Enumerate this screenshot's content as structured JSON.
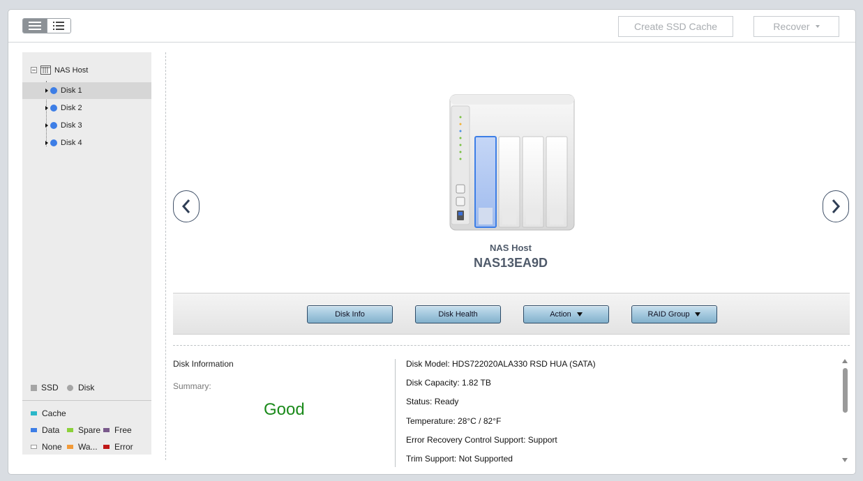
{
  "toolbar": {
    "create_ssd_cache": "Create SSD Cache",
    "recover": "Recover"
  },
  "tree": {
    "root": "NAS Host",
    "disks": [
      "Disk 1",
      "Disk 2",
      "Disk 3",
      "Disk 4"
    ],
    "selected_index": 0
  },
  "legend": {
    "ssd": "SSD",
    "disk": "Disk",
    "cache": "Cache",
    "data": "Data",
    "spare": "Spare",
    "free": "Free",
    "none": "None",
    "warning": "Wa...",
    "error": "Error",
    "colors": {
      "cache": "#2ab7c9",
      "data": "#3d7ee6",
      "spare": "#8bd13a",
      "free": "#7a5a8c",
      "none": "#ffffff",
      "warning": "#f29a38",
      "error": "#c01818"
    }
  },
  "device": {
    "host_label": "NAS Host",
    "name": "NAS13EA9D"
  },
  "actions": {
    "disk_info": "Disk Info",
    "disk_health": "Disk Health",
    "action": "Action",
    "raid_group": "RAID Group"
  },
  "disk_info": {
    "heading": "Disk Information",
    "summary_label": "Summary:",
    "summary_value": "Good",
    "summary_color": "#1b8a1b",
    "specs": [
      "Disk Model: HDS722020ALA330 RSD HUA (SATA)",
      "Disk Capacity: 1.82 TB",
      "Status: Ready",
      "Temperature: 28°C / 82°F",
      "Error Recovery Control Support: Support",
      "Trim Support: Not Supported"
    ]
  }
}
